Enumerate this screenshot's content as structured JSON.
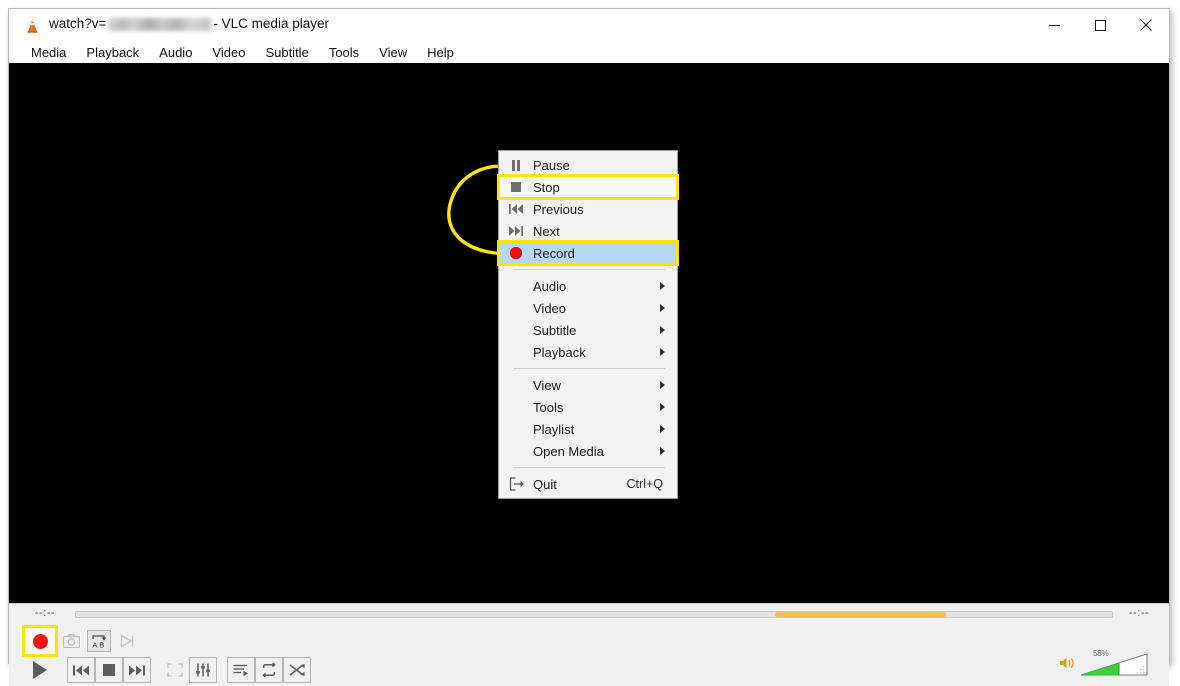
{
  "window": {
    "app_name": "VLC media player",
    "title_prefix": "watch?v=",
    "title_redacted": "",
    "title_suffix": "- VLC media player",
    "icon": "vlc-cone-icon",
    "controls": {
      "minimize": "–",
      "maximize": "☐",
      "close": "✕"
    }
  },
  "menubar": {
    "items": [
      {
        "label": "Media"
      },
      {
        "label": "Playback"
      },
      {
        "label": "Audio"
      },
      {
        "label": "Video"
      },
      {
        "label": "Subtitle"
      },
      {
        "label": "Tools"
      },
      {
        "label": "View"
      },
      {
        "label": "Help"
      }
    ]
  },
  "context_menu": {
    "items": [
      {
        "label": "Pause",
        "icon": "pause-icon",
        "shortcut": "",
        "submenu": false,
        "highlight": "none"
      },
      {
        "label": "Stop",
        "icon": "stop-icon",
        "shortcut": "",
        "submenu": false,
        "highlight": "outline"
      },
      {
        "label": "Previous",
        "icon": "previous-icon",
        "shortcut": "",
        "submenu": false,
        "highlight": "none"
      },
      {
        "label": "Next",
        "icon": "next-icon",
        "shortcut": "",
        "submenu": false,
        "highlight": "none"
      },
      {
        "label": "Record",
        "icon": "record-icon",
        "shortcut": "",
        "submenu": false,
        "highlight": "selected"
      },
      {
        "separator": true
      },
      {
        "label": "Audio",
        "icon": "",
        "shortcut": "",
        "submenu": true,
        "highlight": "none"
      },
      {
        "label": "Video",
        "icon": "",
        "shortcut": "",
        "submenu": true,
        "highlight": "none"
      },
      {
        "label": "Subtitle",
        "icon": "",
        "shortcut": "",
        "submenu": true,
        "highlight": "none"
      },
      {
        "label": "Playback",
        "icon": "",
        "shortcut": "",
        "submenu": true,
        "highlight": "none"
      },
      {
        "separator": true
      },
      {
        "label": "View",
        "icon": "",
        "shortcut": "",
        "submenu": true,
        "highlight": "none"
      },
      {
        "label": "Tools",
        "icon": "",
        "shortcut": "",
        "submenu": true,
        "highlight": "none"
      },
      {
        "label": "Playlist",
        "icon": "",
        "shortcut": "",
        "submenu": true,
        "highlight": "none"
      },
      {
        "label": "Open Media",
        "icon": "",
        "shortcut": "",
        "submenu": true,
        "highlight": "none"
      },
      {
        "separator": true
      },
      {
        "label": "Quit",
        "icon": "exit-icon",
        "shortcut": "Ctrl+Q",
        "submenu": false,
        "highlight": "none"
      }
    ]
  },
  "annotation": {
    "arrow_color": "#ffe500",
    "highlight_color": "#ffe500",
    "description": "curved arrow from Record to Stop"
  },
  "playback_bar": {
    "time_elapsed": "--:--",
    "time_total": "--:--",
    "buffer_color": "#f0bf5c",
    "secondary_buttons": [
      {
        "name": "record-button",
        "label": "Record",
        "state": "highlighted"
      },
      {
        "name": "snapshot-button",
        "label": "Take Snapshot",
        "state": "disabled"
      },
      {
        "name": "ab-loop-button",
        "label": "A to B Loop",
        "state": "enabled"
      },
      {
        "name": "frame-by-frame-button",
        "label": "Frame by Frame",
        "state": "disabled"
      }
    ],
    "primary_buttons": [
      {
        "name": "play-button",
        "label": "Play"
      },
      {
        "name": "previous-button",
        "label": "Previous"
      },
      {
        "name": "stop-button",
        "label": "Stop"
      },
      {
        "name": "next-button",
        "label": "Next"
      },
      {
        "name": "fullscreen-button",
        "label": "Toggle Fullscreen"
      },
      {
        "name": "equalizer-button",
        "label": "Show Extended Settings"
      },
      {
        "name": "playlist-button",
        "label": "Show Playlist"
      },
      {
        "name": "loop-button",
        "label": "Loop"
      },
      {
        "name": "shuffle-button",
        "label": "Random"
      }
    ],
    "volume": {
      "percent_label": "58%",
      "level": 58,
      "icon": "speaker-icon",
      "fill_color": "#2ecb2e"
    }
  }
}
